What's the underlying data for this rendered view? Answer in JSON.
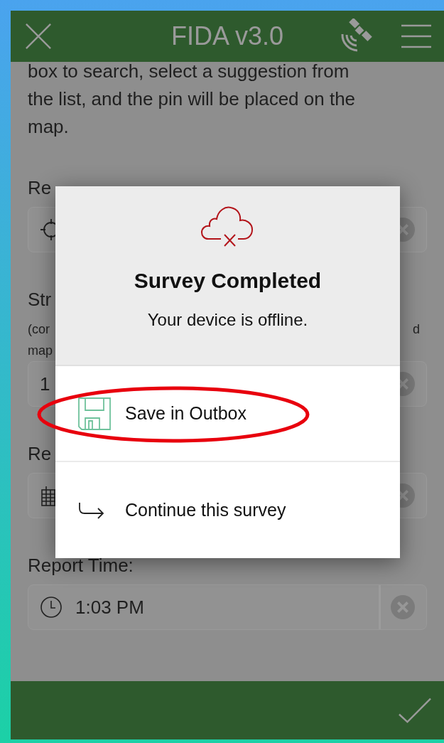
{
  "header": {
    "title": "FIDA v3.0"
  },
  "intro": "box to search, select a suggestion from the list, and the pin will be placed on the map.",
  "fields": [
    {
      "kind": "location",
      "label": "Re"
    },
    {
      "kind": "text",
      "label": "Str",
      "hint_lines": [
        {
          "left": "(cor",
          "right": "d"
        },
        {
          "left": "map"
        }
      ],
      "value": "1"
    },
    {
      "kind": "date",
      "label": "Re"
    },
    {
      "kind": "time",
      "label": "Report Time:",
      "value": "1:03 PM"
    }
  ],
  "dialog": {
    "title": "Survey Completed",
    "message": "Your device is offline.",
    "actions": [
      {
        "kind": "save",
        "label": "Save in Outbox",
        "highlighted": true
      },
      {
        "kind": "continue",
        "label": "Continue this survey",
        "highlighted": false
      }
    ]
  }
}
